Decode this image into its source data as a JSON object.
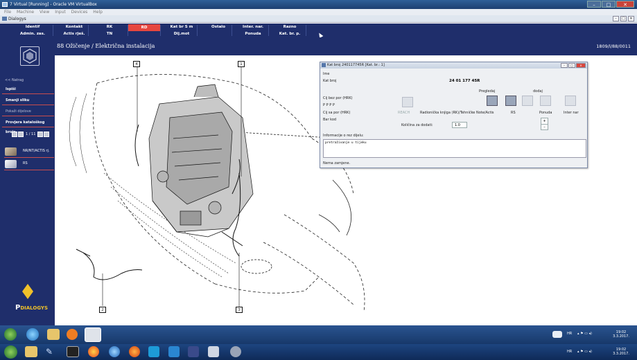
{
  "vbox": {
    "title": "7 Virtual [Running] - Oracle VM VirtualBox",
    "menu": [
      "File",
      "Machine",
      "View",
      "Input",
      "Devices",
      "Help"
    ],
    "controls": {
      "min": "–",
      "restore": "□",
      "close": "✕"
    }
  },
  "dialog_bar": {
    "title": "Dialogys"
  },
  "nav": {
    "row1": [
      "Identif",
      "Kontakt",
      "RK",
      "RD",
      "Kat br S m",
      "Ostalo",
      "Inter. nar.",
      "Razno"
    ],
    "row2": [
      "Admin. zas.",
      "Actis rješ.",
      "TN",
      "",
      "Dij.mot",
      "",
      "Ponuda",
      "Kat. br. p."
    ],
    "active": "RD"
  },
  "header": {
    "title": "88 Ožičenje / Električna instalacija",
    "code": "1809/l/88/0011"
  },
  "sidebar": {
    "back": "<< Natrag",
    "items": [
      "Ispiši",
      "Smanji sliku",
      "Pokaži dijelove",
      "Provjera kataloškog broja"
    ],
    "pager": "1 / 11",
    "docs": [
      {
        "label": "NR/NT/ACTIS rj."
      },
      {
        "label": "RS"
      }
    ],
    "brand_prefix": "P",
    "brand": "DIALOGYS"
  },
  "callouts": [
    "4",
    "1",
    "2",
    "3"
  ],
  "popup": {
    "title": "Kat broj 240117745R [Kat. br.: 1]",
    "labels": {
      "ime": "Ime",
      "kat_broj": "Kat broj",
      "cij_bez": "Cij bez por (HRK)",
      "pppp": "P P P P",
      "cij_sa": "Cij sa por (HRK)",
      "bar": "Bar kod",
      "pregledaj": "Pregledaj",
      "dodaj": "dodaj",
      "reach": "REACH",
      "radionicka": "Radionička knjiga (RK)/Tehničke Note/Actis",
      "rs": "RS",
      "ponuda": "Ponuda",
      "inter_nar": "Inter nar",
      "kolicina": "Količina za dodati:",
      "informacije": "Informacije o rez dijelu:",
      "nema": "Nema zamjene."
    },
    "kat_broj_value": "24 01 177 45R",
    "quantity": "1.0",
    "notes_text": "pretraživanje u tijeku",
    "spin": {
      "up": "+",
      "down": "–"
    }
  },
  "taskbar_top": {
    "lang": "HR",
    "time": "19:02",
    "date": "3.3.2017."
  },
  "taskbar_bottom": {
    "lang": "HR",
    "time": "19:02",
    "date": "3.3.2017."
  },
  "colors": {
    "navy": "#1f2e6b",
    "active_tab": "#e6463f",
    "renault": "#f0c12a"
  }
}
